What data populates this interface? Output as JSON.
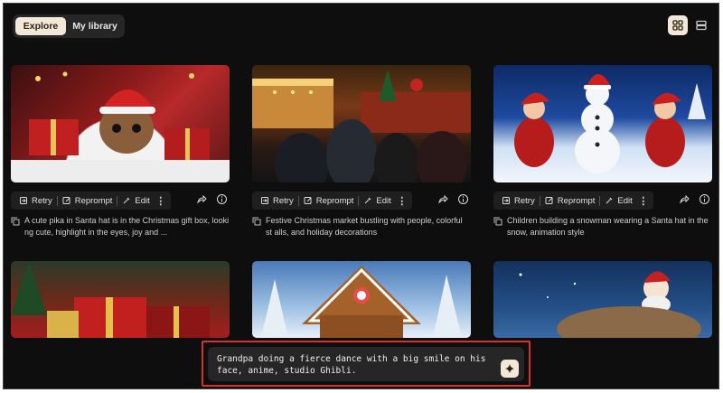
{
  "tabs": {
    "explore": "Explore",
    "library": "My library"
  },
  "actions": {
    "retry": "Retry",
    "reprompt": "Reprompt",
    "edit": "Edit",
    "more": "⋮"
  },
  "cards": [
    {
      "caption": "A cute pika in Santa hat is in the Christmas gift box, looki ng cute, highlight in the eyes, joy and ..."
    },
    {
      "caption": "Festive Christmas market bustling with people, colorful st alls, and holiday decorations"
    },
    {
      "caption": "Children building a snowman wearing a Santa hat in the snow, animation style"
    }
  ],
  "prompt": {
    "text": "Grandpa doing a fierce dance with a big smile on his face, anime, studio Ghibli."
  },
  "colors": {
    "accent": "#f3e8d8",
    "highlight_border": "#d9302c",
    "background": "#0e0e0e"
  }
}
